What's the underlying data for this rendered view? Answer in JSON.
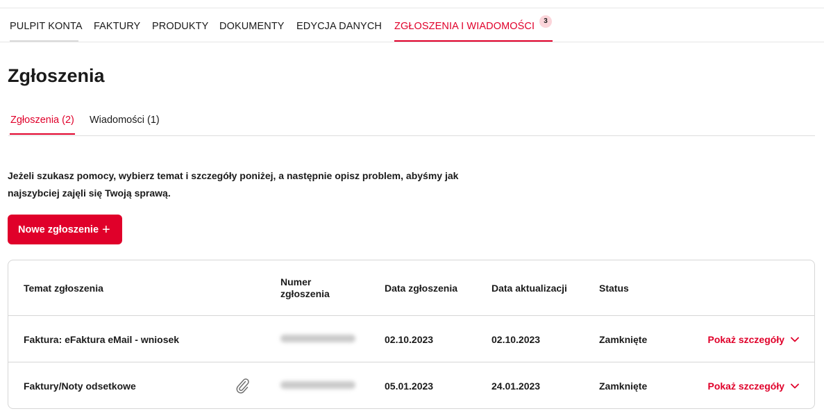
{
  "nav": {
    "items": [
      {
        "label": "PULPIT KONTA"
      },
      {
        "label": "FAKTURY"
      },
      {
        "label": "PRODUKTY"
      },
      {
        "label": "DOKUMENTY"
      },
      {
        "label": "EDYCJA DANYCH"
      },
      {
        "label": "ZGŁOSZENIA I WIADOMOŚCI"
      }
    ],
    "active_index": 5,
    "badge": "3"
  },
  "page": {
    "title": "Zgłoszenia"
  },
  "tabs": [
    {
      "label": "Zgłoszenia (2)",
      "active": true
    },
    {
      "label": "Wiadomości (1)",
      "active": false
    }
  ],
  "help_text": "Jeżeli szukasz pomocy, wybierz temat i szczegóły poniżej, a następnie opisz problem, abyśmy jak najszybciej zajęli się Twoją sprawą.",
  "new_button": {
    "label": "Nowe zgłoszenie",
    "icon": "plus-icon"
  },
  "table": {
    "headers": {
      "topic": "Temat zgłoszenia",
      "number": "Numer zgłoszenia",
      "created": "Data zgłoszenia",
      "updated": "Data aktualizacji",
      "status": "Status"
    },
    "rows": [
      {
        "topic": "Faktura: eFaktura eMail - wniosek",
        "has_attachment": false,
        "number_hidden": true,
        "created": "02.10.2023",
        "updated": "02.10.2023",
        "status": "Zamknięte",
        "details_label": "Pokaż szczegóły"
      },
      {
        "topic": "Faktury/Noty odsetkowe",
        "has_attachment": true,
        "number_hidden": true,
        "created": "05.01.2023",
        "updated": "24.01.2023",
        "status": "Zamknięte",
        "details_label": "Pokaż szczegóły"
      }
    ]
  },
  "colors": {
    "accent": "#e0002a",
    "badge_bg": "#fbd5da",
    "border": "#d6d6d6"
  },
  "icons": {
    "attachment": "paperclip-icon",
    "expand": "chevron-down-icon"
  }
}
